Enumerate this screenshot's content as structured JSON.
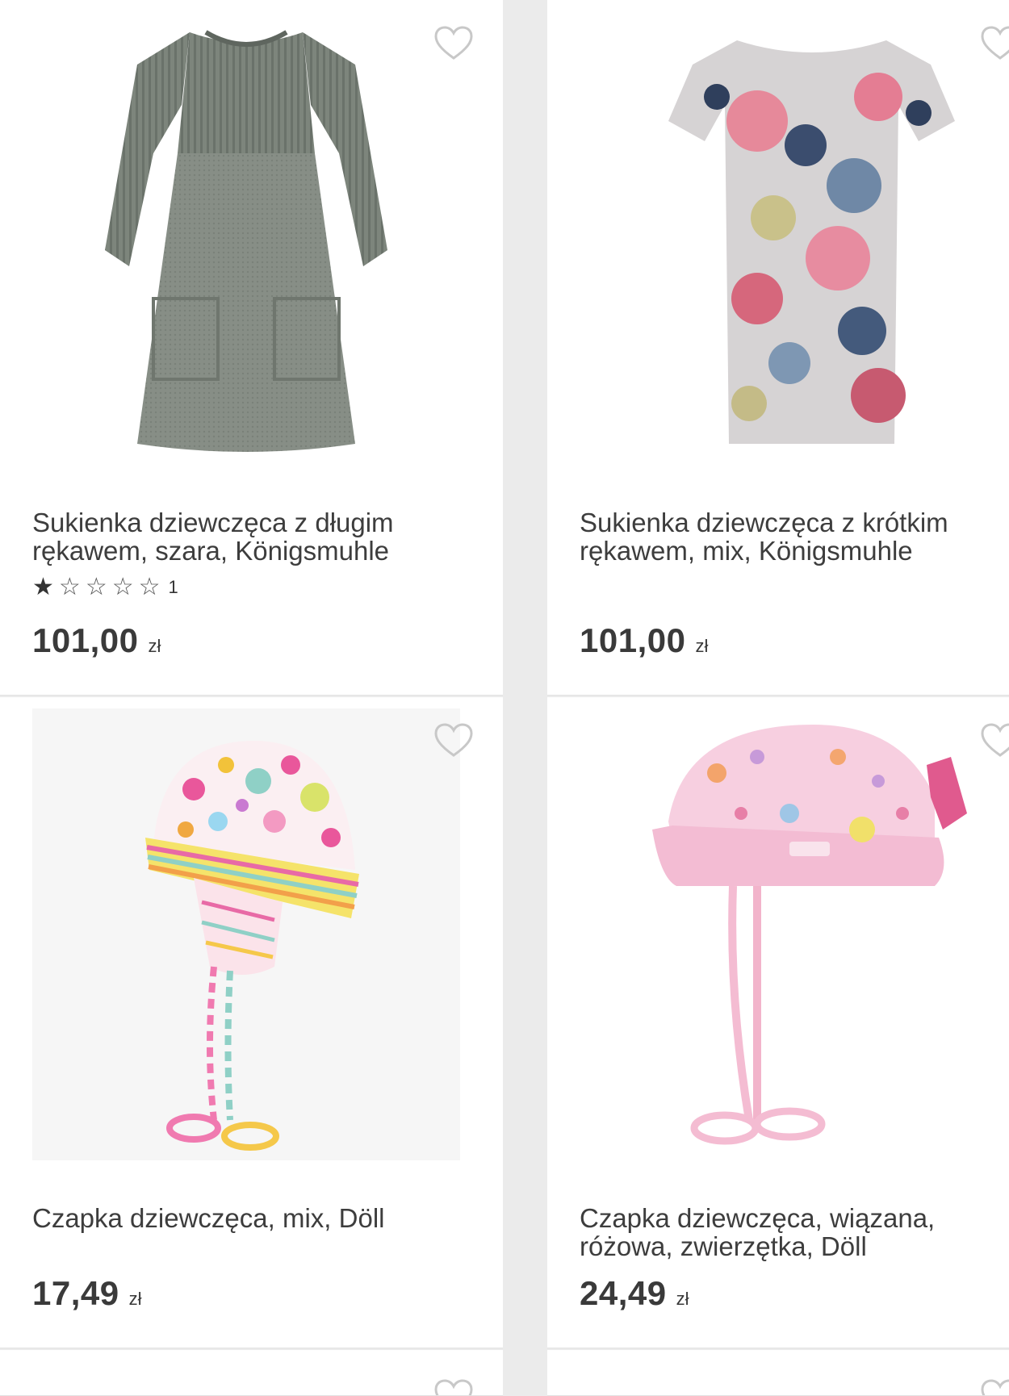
{
  "products": [
    {
      "title": "Sukienka dziewczęca z długim rękawem, szara, Königsmuhle",
      "rating": 1,
      "rating_count": "1",
      "price": "101,00",
      "currency": "zł",
      "image": "grey-knit-dress-image"
    },
    {
      "title": "Sukienka dziewczęca z krótkim rękawem, mix, Königsmuhle",
      "price": "101,00",
      "currency": "zł",
      "image": "floral-dress-image"
    },
    {
      "title": "Czapka dziewczęca, mix, Döll",
      "price": "17,49",
      "currency": "zł",
      "image": "striped-polka-dot-hat-image"
    },
    {
      "title": "Czapka dziewczęca, wiązana, różowa, zwierzętka, Döll",
      "price": "24,49",
      "currency": "zł",
      "image": "pink-animal-hat-image"
    }
  ],
  "icons": {
    "wishlist": "heart-outline-icon",
    "star_filled": "star-filled-icon",
    "star_empty": "star-outline-icon"
  },
  "colors": {
    "background": "#ebebeb",
    "card": "#ffffff",
    "text": "#3d3d3d"
  }
}
